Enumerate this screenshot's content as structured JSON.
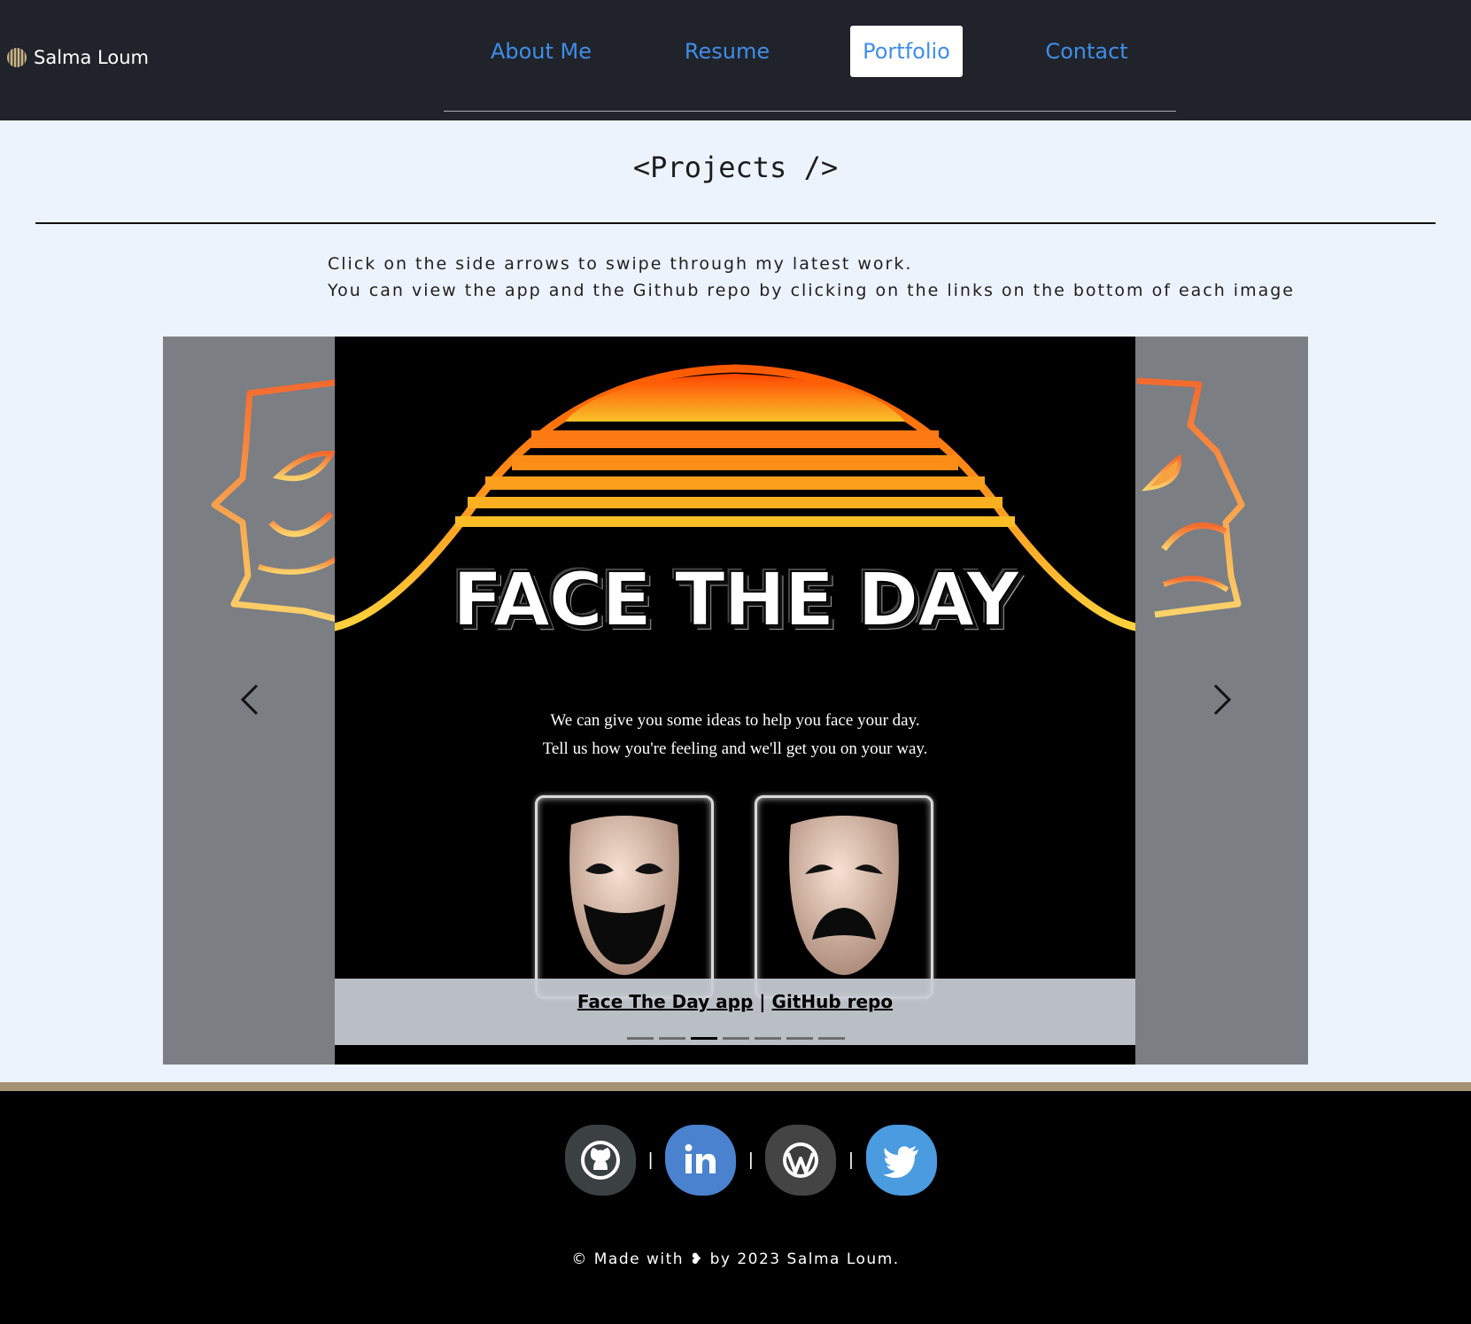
{
  "navbar": {
    "brand": "Salma Loum",
    "links": [
      "About Me",
      "Resume",
      "Portfolio",
      "Contact"
    ],
    "active_link": "Portfolio"
  },
  "projects": {
    "title": "<Projects />",
    "intro_line1": "Click on the side arrows to swipe through my latest work.",
    "intro_line2": "You can view the app and the Github repo by clicking on the links on the bottom of each image"
  },
  "carousel": {
    "slide_title": "FACE THE DAY",
    "tagline_line1": "We can give you some ideas to help you face your day.",
    "tagline_line2": "Tell us how you're feeling and we'll get you on your way.",
    "app_link": "Face The Day app",
    "separator": "|",
    "repo_link": "GitHub repo",
    "indicator_count": 7,
    "active_indicator": 3
  },
  "footer": {
    "social_icons": [
      "github-icon",
      "linkedin-icon",
      "wordpress-icon",
      "twitter-icon"
    ],
    "separator": "|",
    "copyright": "© Made with ❥ by 2023 Salma Loum."
  },
  "colors": {
    "navbar_bg": "#20232a",
    "nav_link": "#3f8ee8",
    "page_bg": "#edf3fd",
    "carousel_side": "#7b7e83",
    "footer_bg": "#000000",
    "footer_border": "#a49274"
  }
}
